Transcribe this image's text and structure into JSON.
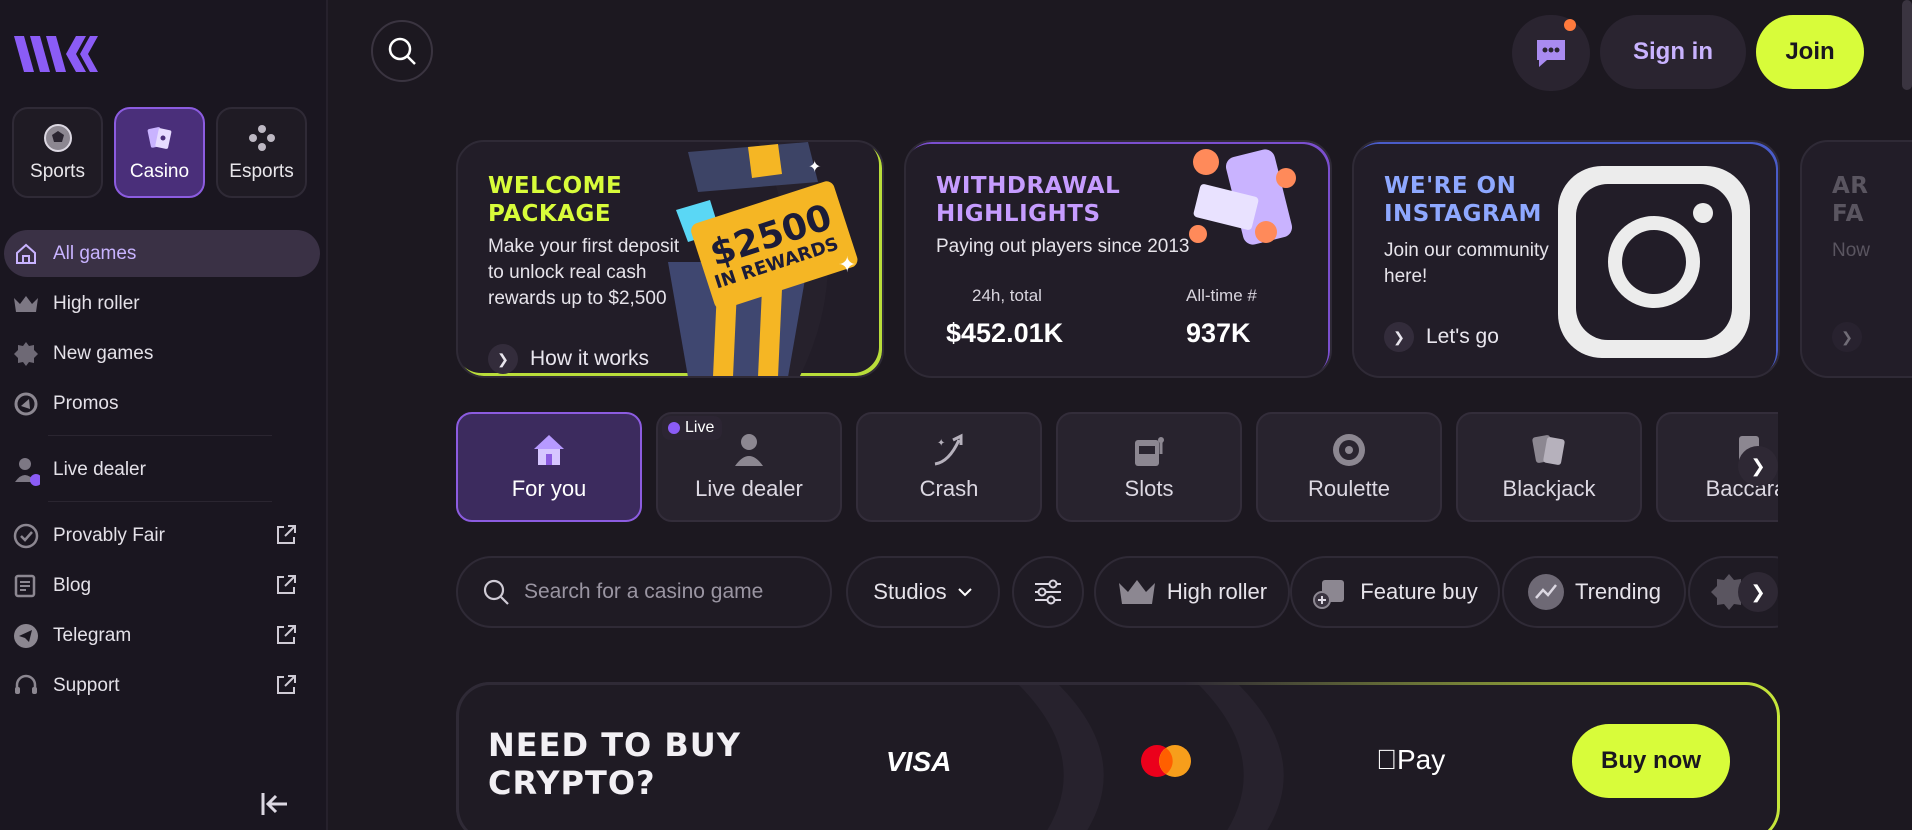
{
  "sidebar": {
    "top_tabs": [
      {
        "label": "Sports",
        "icon": "soccer-ball-icon"
      },
      {
        "label": "Casino",
        "icon": "cards-icon",
        "active": true
      },
      {
        "label": "Esports",
        "icon": "gamepad-icon"
      }
    ],
    "nav": [
      {
        "label": "All games",
        "icon": "home-icon",
        "active": true
      },
      {
        "label": "High roller",
        "icon": "crown-icon"
      },
      {
        "label": "New games",
        "icon": "new-badge-icon"
      },
      {
        "label": "Promos",
        "icon": "megaphone-icon"
      },
      {
        "label": "Live dealer",
        "icon": "dealer-icon"
      },
      {
        "label": "Provably Fair",
        "icon": "check-badge-icon",
        "external": true
      },
      {
        "label": "Blog",
        "icon": "blog-icon",
        "external": true
      },
      {
        "label": "Telegram",
        "icon": "telegram-icon",
        "external": true
      },
      {
        "label": "Support",
        "icon": "headset-icon",
        "external": true
      }
    ]
  },
  "header": {
    "sign_in": "Sign in",
    "join": "Join"
  },
  "promos": {
    "welcome": {
      "title": "WELCOME PACKAGE",
      "desc": "Make your first deposit to unlock real cash rewards up to $2,500",
      "badge_amount": "$2500",
      "badge_text": "IN REWARDS",
      "link": "How it works"
    },
    "withdrawal": {
      "title": "WITHDRAWAL HIGHLIGHTS",
      "desc": "Paying out players since 2013",
      "stat1_label": "24h, total",
      "stat1_value": "$452.01K",
      "stat2_label": "All-time #",
      "stat2_value": "937K"
    },
    "instagram": {
      "title": "WE'RE ON INSTAGRAM",
      "desc": "Join our community here!",
      "link": "Let's go"
    },
    "partial": {
      "title": "AR FA",
      "desc": "Now"
    }
  },
  "categories": [
    {
      "label": "For you",
      "icon": "home-icon",
      "active": true
    },
    {
      "label": "Live dealer",
      "icon": "dealer-icon",
      "badge": "Live"
    },
    {
      "label": "Crash",
      "icon": "rocket-trend-icon"
    },
    {
      "label": "Slots",
      "icon": "slot-machine-icon"
    },
    {
      "label": "Roulette",
      "icon": "roulette-icon"
    },
    {
      "label": "Blackjack",
      "icon": "blackjack-cards-icon"
    },
    {
      "label": "Baccarat",
      "icon": "baccarat-icon"
    }
  ],
  "filters": {
    "search_placeholder": "Search for a casino game",
    "studios": "Studios",
    "pills": [
      {
        "label": "High roller",
        "icon": "crown-icon"
      },
      {
        "label": "Feature buy",
        "icon": "feature-buy-icon"
      },
      {
        "label": "Trending",
        "icon": "trending-icon"
      }
    ]
  },
  "crypto": {
    "title_line1": "NEED TO BUY",
    "title_line2": "CRYPTO?",
    "visa": "VISA",
    "applepay": "Pay",
    "buy": "Buy now"
  },
  "colors": {
    "accent_purple": "#8c5ce0",
    "accent_lime": "#d8fc3a",
    "title_lime": "#d8fc3a",
    "title_purple": "#c69cff",
    "title_blue": "#8ea8ff"
  }
}
